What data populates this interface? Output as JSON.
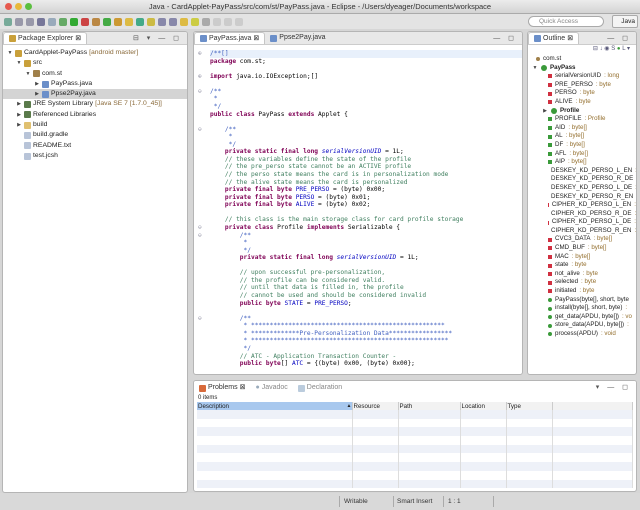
{
  "window": {
    "title": "Java - CardApplet-PayPass/src/com/st/PayPass.java - Eclipse - /Users/dyeager/Documents/workspace"
  },
  "toolbar": {
    "quick_access_placeholder": "Quick Access",
    "perspective": "Java"
  },
  "package_explorer": {
    "tab": "Package Explorer",
    "items": [
      {
        "indent": 0,
        "tw": "▼",
        "icon": "project-icon",
        "color": "#c9a03a",
        "label": "CardApplet-PayPass",
        "extra": "[android master]"
      },
      {
        "indent": 1,
        "tw": "▼",
        "icon": "source-folder-icon",
        "color": "#c9a03a",
        "label": "src",
        "extra": ""
      },
      {
        "indent": 2,
        "tw": "▼",
        "icon": "package-icon",
        "color": "#a0804a",
        "label": "com.st",
        "extra": ""
      },
      {
        "indent": 3,
        "tw": "▶",
        "icon": "java-file-icon",
        "color": "#6b8fc9",
        "label": "PayPass.java",
        "extra": ""
      },
      {
        "indent": 3,
        "tw": "▶",
        "icon": "java-file-icon",
        "color": "#6b8fc9",
        "label": "Ppse2Pay.java",
        "extra": "",
        "selected": true
      },
      {
        "indent": 1,
        "tw": "▶",
        "icon": "library-icon",
        "color": "#5a7a4a",
        "label": "JRE System Library",
        "extra": "[Java SE 7 [1.7.0_45]]"
      },
      {
        "indent": 1,
        "tw": "▶",
        "icon": "library-icon",
        "color": "#5a7a4a",
        "label": "Referenced Libraries",
        "extra": ""
      },
      {
        "indent": 1,
        "tw": "▶",
        "icon": "folder-icon",
        "color": "#e0c070",
        "label": "build",
        "extra": ""
      },
      {
        "indent": 1,
        "tw": "",
        "icon": "file-icon",
        "color": "#b8c4d8",
        "label": "build.gradle",
        "extra": ""
      },
      {
        "indent": 1,
        "tw": "",
        "icon": "file-icon",
        "color": "#b8c4d8",
        "label": "README.txt",
        "extra": ""
      },
      {
        "indent": 1,
        "tw": "",
        "icon": "file-icon",
        "color": "#b8c4d8",
        "label": "test.jcsh",
        "extra": ""
      }
    ]
  },
  "editor": {
    "tabs": [
      "PayPass.java",
      "Ppse2Pay.java"
    ],
    "lines": [
      [
        [
          "j",
          "/**[]"
        ]
      ],
      [
        [
          "k",
          "package"
        ],
        [
          "t",
          " com.st;"
        ]
      ],
      [],
      [
        [
          "k",
          "import"
        ],
        [
          "t",
          " java.io.IOException;[]"
        ]
      ],
      [],
      [
        [
          "j",
          "/**"
        ]
      ],
      [
        [
          "j",
          " *"
        ]
      ],
      [
        [
          "j",
          " */"
        ]
      ],
      [
        [
          "k",
          "public class"
        ],
        [
          "t",
          " PayPass "
        ],
        [
          "k",
          "extends"
        ],
        [
          "t",
          " Applet {"
        ]
      ],
      [],
      [
        [
          "j",
          "    /**"
        ]
      ],
      [
        [
          "j",
          "     *"
        ]
      ],
      [
        [
          "j",
          "     */"
        ]
      ],
      [
        [
          "k",
          "    private static final long "
        ],
        [
          "fi",
          "serialVersionUID"
        ],
        [
          "t",
          " = 1L;"
        ]
      ],
      [
        [
          "c",
          "    // these variables define the state of the profile"
        ]
      ],
      [
        [
          "c",
          "    // the pre_perso state cannot be an ACTIVE profile"
        ]
      ],
      [
        [
          "c",
          "    // the perso state means the card is in personalization mode"
        ]
      ],
      [
        [
          "c",
          "    // the alive state means the card is personalized"
        ]
      ],
      [
        [
          "k",
          "    private final byte "
        ],
        [
          "f",
          "PRE_PERSO"
        ],
        [
          "t",
          " = (byte) 0x00;"
        ]
      ],
      [
        [
          "k",
          "    private final byte "
        ],
        [
          "f",
          "PERSO"
        ],
        [
          "t",
          " = (byte) 0x01;"
        ]
      ],
      [
        [
          "k",
          "    private final byte "
        ],
        [
          "f",
          "ALIVE"
        ],
        [
          "t",
          " = (byte) 0x02;"
        ]
      ],
      [],
      [
        [
          "c",
          "    // this class is the main storage class for card profile storage"
        ]
      ],
      [
        [
          "k",
          "    private class"
        ],
        [
          "t",
          " Profile "
        ],
        [
          "k",
          "implements"
        ],
        [
          "t",
          " Serializable {"
        ]
      ],
      [
        [
          "j",
          "        /**"
        ]
      ],
      [
        [
          "j",
          "         *"
        ]
      ],
      [
        [
          "j",
          "         */"
        ]
      ],
      [
        [
          "k",
          "        private static final long "
        ],
        [
          "fi",
          "serialVersionUID"
        ],
        [
          "t",
          " = 1L;"
        ]
      ],
      [],
      [
        [
          "c",
          "        // upon successful pre-personalization,"
        ]
      ],
      [
        [
          "c",
          "        // the profile can be considered valid."
        ]
      ],
      [
        [
          "c",
          "        // until that data is filled in, the profile"
        ]
      ],
      [
        [
          "c",
          "        // cannot be used and should be considered invalid"
        ]
      ],
      [
        [
          "k",
          "        public byte "
        ],
        [
          "f",
          "STATE"
        ],
        [
          "t",
          " = "
        ],
        [
          "f",
          "PRE_PERSO"
        ],
        [
          "t",
          ";"
        ]
      ],
      [],
      [
        [
          "j",
          "        /**"
        ]
      ],
      [
        [
          "j",
          "         * ****************************************************"
        ]
      ],
      [
        [
          "j",
          "         * *************Pre-Personalization Data*****************"
        ]
      ],
      [
        [
          "j",
          "         * *****************************************************"
        ]
      ],
      [
        [
          "j",
          "         */"
        ]
      ],
      [
        [
          "c",
          "        // ATC - Application Transaction Counter -"
        ]
      ],
      [
        [
          "k",
          "        public byte"
        ],
        [
          "t",
          "[] "
        ],
        [
          "f",
          "ATC"
        ],
        [
          "t",
          " = {(byte) 0x00, (byte) 0x00};"
        ]
      ]
    ]
  },
  "outline": {
    "tab": "Outline",
    "items": [
      {
        "indent": 0,
        "kind": "package",
        "color": "#a0804a",
        "name": "com.st",
        "type": ""
      },
      {
        "indent": 0,
        "kind": "class",
        "color": "#3a9a3a",
        "name": "PayPass",
        "type": ""
      },
      {
        "indent": 1,
        "kind": "field",
        "color": "#d03040",
        "name": "serialVersionUID",
        "type": " : long"
      },
      {
        "indent": 1,
        "kind": "field",
        "color": "#d03040",
        "name": "PRE_PERSO",
        "type": " : byte"
      },
      {
        "indent": 1,
        "kind": "field",
        "color": "#d03040",
        "name": "PERSO",
        "type": " : byte"
      },
      {
        "indent": 1,
        "kind": "field",
        "color": "#d03040",
        "name": "ALIVE",
        "type": " : byte"
      },
      {
        "indent": 1,
        "kind": "class",
        "color": "#3a9a3a",
        "name": "Profile",
        "type": ""
      },
      {
        "indent": 1,
        "kind": "field",
        "color": "#3a9a3a",
        "name": "PROFILE",
        "type": " : Profile"
      },
      {
        "indent": 1,
        "kind": "field",
        "color": "#3a9a3a",
        "name": "AID",
        "type": " : byte[]"
      },
      {
        "indent": 1,
        "kind": "field",
        "color": "#3a9a3a",
        "name": "AL",
        "type": " : byte[]"
      },
      {
        "indent": 1,
        "kind": "field",
        "color": "#3a9a3a",
        "name": "DF",
        "type": " : byte[]"
      },
      {
        "indent": 1,
        "kind": "field",
        "color": "#3a9a3a",
        "name": "AFL",
        "type": " : byte[]"
      },
      {
        "indent": 1,
        "kind": "field",
        "color": "#3a9a3a",
        "name": "AIP",
        "type": " : byte[]"
      },
      {
        "indent": 1,
        "kind": "field",
        "color": "#d03040",
        "name": "DESKEY_KD_PERSO_L_EN",
        "type": " :"
      },
      {
        "indent": 1,
        "kind": "field",
        "color": "#d03040",
        "name": "DESKEY_KD_PERSO_R_DE",
        "type": " :"
      },
      {
        "indent": 1,
        "kind": "field",
        "color": "#d03040",
        "name": "DESKEY_KD_PERSO_L_DE",
        "type": " :"
      },
      {
        "indent": 1,
        "kind": "field",
        "color": "#d03040",
        "name": "DESKEY_KD_PERSO_R_EN",
        "type": " :"
      },
      {
        "indent": 1,
        "kind": "field",
        "color": "#d03040",
        "name": "CIPHER_KD_PERSO_L_EN",
        "type": " :"
      },
      {
        "indent": 1,
        "kind": "field",
        "color": "#d03040",
        "name": "CIPHER_KD_PERSO_R_DE",
        "type": " :"
      },
      {
        "indent": 1,
        "kind": "field",
        "color": "#d03040",
        "name": "CIPHER_KD_PERSO_L_DE",
        "type": " :"
      },
      {
        "indent": 1,
        "kind": "field",
        "color": "#d03040",
        "name": "CIPHER_KD_PERSO_R_EN",
        "type": " :"
      },
      {
        "indent": 1,
        "kind": "field",
        "color": "#d03040",
        "name": "CVC3_DATA",
        "type": " : byte[]"
      },
      {
        "indent": 1,
        "kind": "field",
        "color": "#d03040",
        "name": "CMD_BUF",
        "type": " : byte[]"
      },
      {
        "indent": 1,
        "kind": "field",
        "color": "#d03040",
        "name": "MAC",
        "type": " : byte[]"
      },
      {
        "indent": 1,
        "kind": "field",
        "color": "#d03040",
        "name": "state",
        "type": " : byte"
      },
      {
        "indent": 1,
        "kind": "field",
        "color": "#d03040",
        "name": "not_alive",
        "type": " : byte"
      },
      {
        "indent": 1,
        "kind": "field",
        "color": "#d03040",
        "name": "selected",
        "type": " : byte"
      },
      {
        "indent": 1,
        "kind": "field",
        "color": "#d03040",
        "name": "initiated",
        "type": " : byte"
      },
      {
        "indent": 1,
        "kind": "method",
        "color": "#3a9a3a",
        "name": "PayPass(byte[], short, byte",
        "type": ""
      },
      {
        "indent": 1,
        "kind": "method",
        "color": "#3a9a3a",
        "name": "install(byte[], short, byte)",
        "type": " :"
      },
      {
        "indent": 1,
        "kind": "method",
        "color": "#3a9a3a",
        "name": "get_data(APDU, byte[])",
        "type": " : vo"
      },
      {
        "indent": 1,
        "kind": "method",
        "color": "#3a9a3a",
        "name": "store_data(APDU, byte[])",
        "type": " :"
      },
      {
        "indent": 1,
        "kind": "method",
        "color": "#3a9a3a",
        "name": "process(APDU)",
        "type": " : void"
      }
    ]
  },
  "problems": {
    "tabs": [
      "Problems",
      "Javadoc",
      "Declaration"
    ],
    "count": "0 items",
    "columns": [
      "Description",
      "Resource",
      "Path",
      "Location",
      "Type"
    ]
  },
  "status": {
    "writable": "Writable",
    "insert_mode": "Smart Insert",
    "position": "1 : 1"
  }
}
